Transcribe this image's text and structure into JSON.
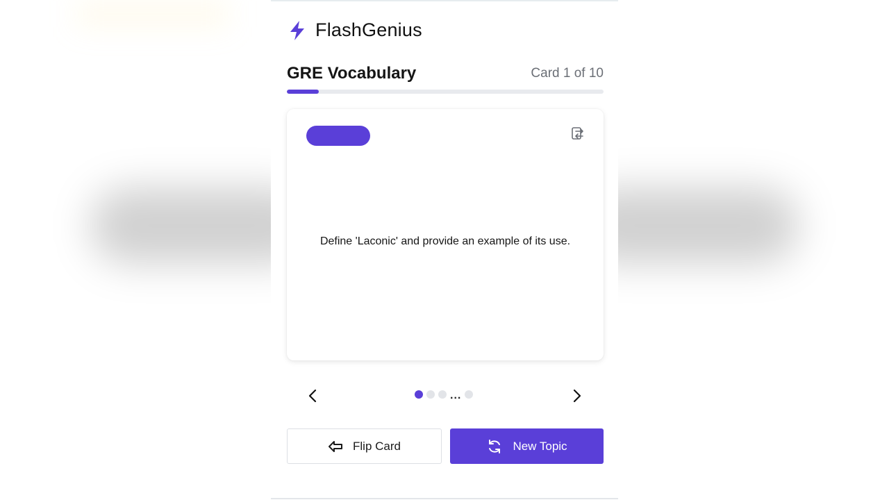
{
  "app": {
    "name": "FlashGenius",
    "logo_icon": "lightning-bolt-icon",
    "accent_color": "#5a3fd8"
  },
  "deck": {
    "title": "GRE Vocabulary",
    "counter": "Card 1 of 10",
    "current_card": 1,
    "total_cards": 10,
    "progress_fraction": 0.1
  },
  "card": {
    "question": "Define 'Laconic' and provide an example of its use.",
    "swap_icon": "swap-icon"
  },
  "navigation": {
    "prev_icon": "chevron-left-icon",
    "next_icon": "chevron-right-icon",
    "ellipsis": "..."
  },
  "actions": {
    "flip_label": "Flip Card",
    "flip_icon": "arrow-left-icon",
    "new_topic_label": "New Topic",
    "new_topic_icon": "refresh-icon"
  }
}
